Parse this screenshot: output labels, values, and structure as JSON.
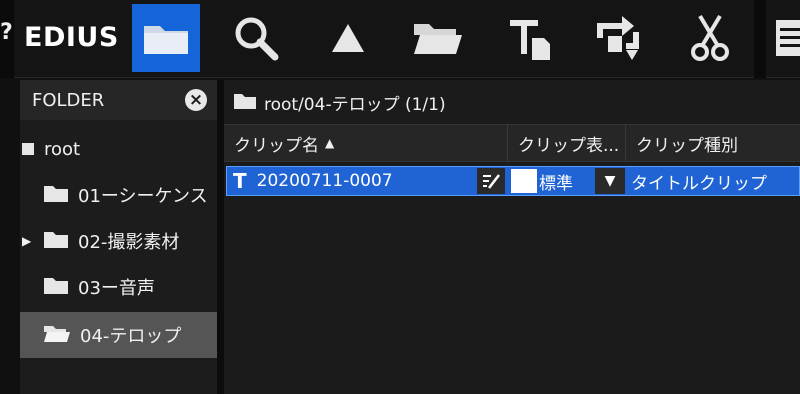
{
  "app": {
    "brand": "EDIUS",
    "left_edge_glyph": "?"
  },
  "toolbar": {
    "buttons": [
      {
        "name": "folder-view-button",
        "icon": "folder-icon",
        "active": true
      },
      {
        "name": "search-button",
        "icon": "magnifier-icon"
      },
      {
        "name": "up-folder-button",
        "icon": "triangle-up-icon"
      },
      {
        "name": "open-folder-button",
        "icon": "open-folder-icon"
      },
      {
        "name": "add-title-button",
        "icon": "title-add-icon"
      },
      {
        "name": "replace-button",
        "icon": "replace-icon"
      },
      {
        "name": "cut-button",
        "icon": "scissors-icon"
      },
      {
        "name": "properties-button",
        "icon": "properties-icon"
      }
    ],
    "accent_color": "#1565d8"
  },
  "folder_panel": {
    "title": "FOLDER",
    "items": [
      {
        "label": "root",
        "level": 0
      },
      {
        "label": "01ーシーケンス",
        "level": 1
      },
      {
        "label": "02-撮影素材",
        "level": 1,
        "collapsed_arrow": true
      },
      {
        "label": "03ー音声",
        "level": 1
      },
      {
        "label": "04-テロップ",
        "level": 1,
        "selected": true
      }
    ]
  },
  "bin": {
    "path": "root/04-テロップ (1/1)",
    "columns": [
      {
        "label": "クリップ名",
        "sorted": "asc",
        "sort_glyph": "▲"
      },
      {
        "label": "クリップ表..."
      },
      {
        "label": "クリップ種別"
      }
    ],
    "clips": [
      {
        "type_glyph": "T",
        "name": "20200711-0007",
        "display": "標準",
        "display_color": "#ffffff",
        "dropdown_glyph": "▼",
        "clip_type": "タイトルクリップ",
        "selected": true
      }
    ],
    "selection_color": "#1f63d4"
  }
}
